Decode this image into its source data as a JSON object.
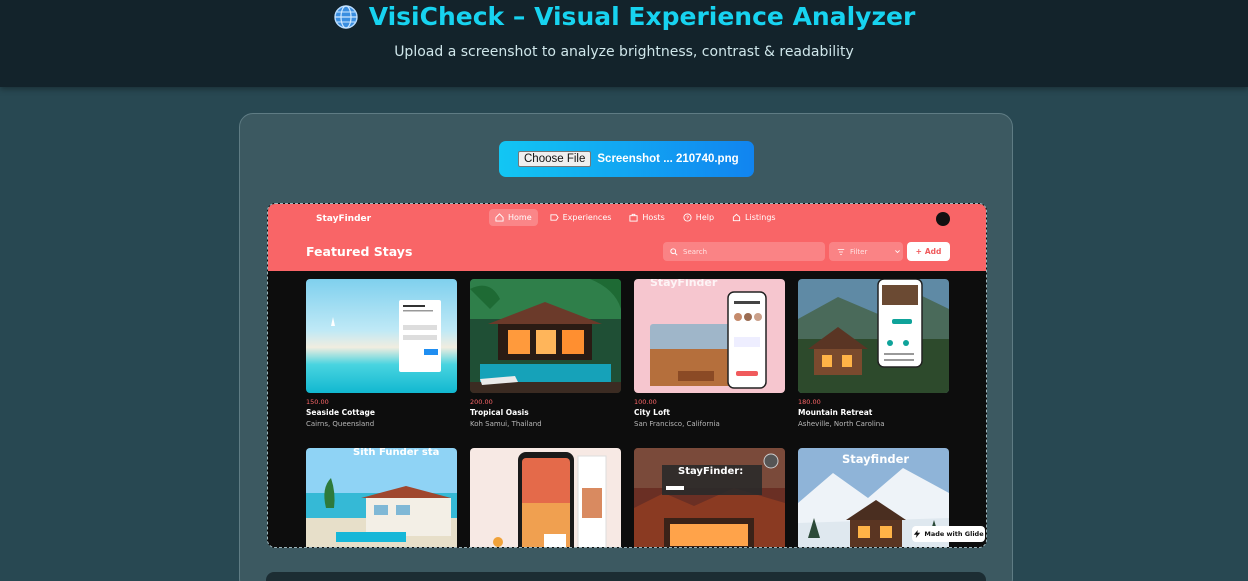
{
  "header": {
    "title": "VisiCheck – Visual Experience Analyzer",
    "subtitle": "Upload a screenshot to analyze brightness, contrast & readability"
  },
  "upload": {
    "button_label": "Choose File",
    "file_name": "Screenshot ... 210740.png"
  },
  "preview": {
    "logo": "StayFinder",
    "nav": [
      {
        "label": "Home",
        "icon": "home-icon"
      },
      {
        "label": "Experiences",
        "icon": "tag-icon"
      },
      {
        "label": "Hosts",
        "icon": "briefcase-icon"
      },
      {
        "label": "Help",
        "icon": "help-icon"
      },
      {
        "label": "Listings",
        "icon": "house-icon"
      }
    ],
    "heading": "Featured Stays",
    "search_placeholder": "Search",
    "filter_label": "Filter",
    "add_label": "Add",
    "cards": [
      {
        "price": "150.00",
        "title": "Seaside Cottage",
        "location": "Cairns, Queensland"
      },
      {
        "price": "200.00",
        "title": "Tropical Oasis",
        "location": "Koh Samui, Thailand"
      },
      {
        "price": "100.00",
        "title": "City Loft",
        "location": "San Francisco, California"
      },
      {
        "price": "180.00",
        "title": "Mountain Retreat",
        "location": "Asheville, North Carolina"
      }
    ],
    "image_texts": {
      "city_loft": "StayFinder",
      "row2_beach": "Sith Funder sta",
      "row2_canyon": "StayFinder:",
      "row2_snow": "Stayfinder"
    },
    "badge": "Made with Glide"
  },
  "colors": {
    "accent": "#17d3f0",
    "stayfinder_red": "#f96567"
  }
}
